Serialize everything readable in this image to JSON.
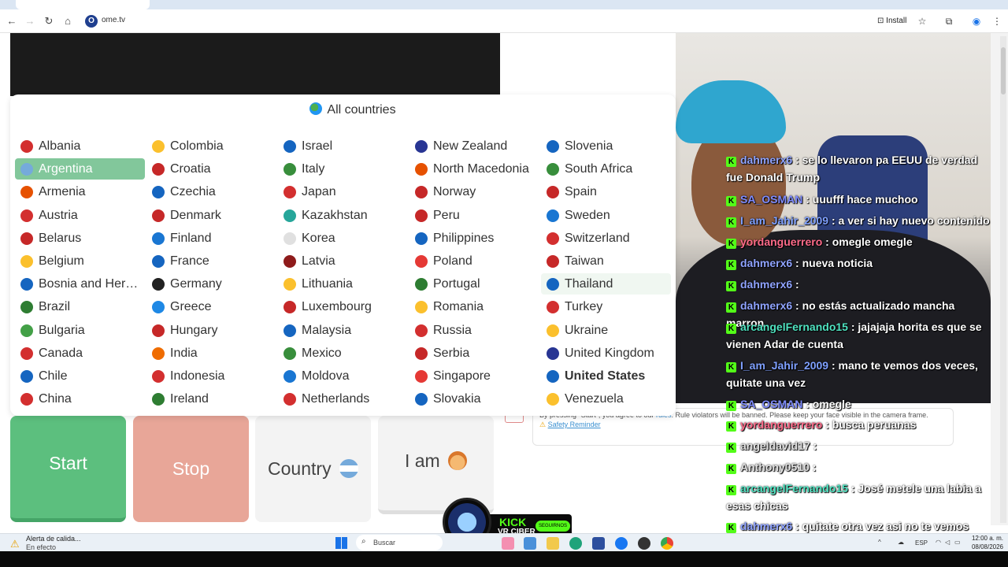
{
  "browser": {
    "url": "ome.tv",
    "install_label": "Install",
    "site_icon_letter": "O"
  },
  "country_panel": {
    "title": "All countries",
    "selected": "Argentina",
    "hovered": "Thailand",
    "columns": [
      [
        "Albania",
        "Argentina",
        "Armenia",
        "Austria",
        "Belarus",
        "Belgium",
        "Bosnia and Her…",
        "Brazil",
        "Bulgaria",
        "Canada",
        "Chile",
        "China"
      ],
      [
        "Colombia",
        "Croatia",
        "Czechia",
        "Denmark",
        "Finland",
        "France",
        "Germany",
        "Greece",
        "Hungary",
        "India",
        "Indonesia",
        "Ireland"
      ],
      [
        "Israel",
        "Italy",
        "Japan",
        "Kazakhstan",
        "Korea",
        "Latvia",
        "Lithuania",
        "Luxembourg",
        "Malaysia",
        "Mexico",
        "Moldova",
        "Netherlands"
      ],
      [
        "New Zealand",
        "North Macedonia",
        "Norway",
        "Peru",
        "Philippines",
        "Poland",
        "Portugal",
        "Romania",
        "Russia",
        "Serbia",
        "Singapore",
        "Slovakia"
      ],
      [
        "Slovenia",
        "South Africa",
        "Spain",
        "Sweden",
        "Switzerland",
        "Taiwan",
        "Thailand",
        "Turkey",
        "Ukraine",
        "United Kingdom",
        "United States",
        "Venezuela"
      ]
    ],
    "bold_items": [
      "United States"
    ]
  },
  "controls": {
    "start_label": "Start",
    "stop_label": "Stop",
    "country_label": "Country",
    "iam_label": "I am"
  },
  "rules": {
    "text_before": "By pressing \"Start\", you agree to our",
    "rules_link": "rules",
    "text_after": ". Rule violators will be banned. Please keep your face visible in the camera frame.",
    "safety_link": "Safety Reminder"
  },
  "chat": {
    "messages": [
      {
        "user": "dahmerx6",
        "color": "#8fa3ff",
        "text": ": se lo llevaron pa EEUU de verdad fue Donald Trump"
      },
      {
        "user": "SA_OSMAN",
        "color": "#7f8cff",
        "text": ": uuufff hace muchoo"
      },
      {
        "user": "I_am_Jahir_2009",
        "color": "#7fa0ff",
        "text": ": a ver si hay nuevo contenido"
      },
      {
        "user": "yordanguerrero",
        "color": "#ff6b8a",
        "text": ": omegle omegle"
      },
      {
        "user": "dahmerx6",
        "color": "#8fa3ff",
        "text": ": nueva noticia"
      },
      {
        "user": "dahmerx6",
        "color": "#8fa3ff",
        "text": ":"
      },
      {
        "user": "dahmerx6",
        "color": "#8fa3ff",
        "text": ": no estás actualizado mancha marron"
      },
      {
        "user": "arcangelFernando15",
        "color": "#4fe3c1",
        "text": ": jajajaja horita es que se vienen Adar de cuenta"
      },
      {
        "user": "I_am_Jahir_2009",
        "color": "#7fa0ff",
        "text": ": mano te vemos dos veces, quitate una vez"
      },
      {
        "user": "SA_OSMAN",
        "color": "#7f8cff",
        "text": ": omegle"
      },
      {
        "user": "yordanguerrero",
        "color": "#ff6b8a",
        "text": ": busca peruanas"
      },
      {
        "user": "angeldavid17",
        "color": "#e0e0e0",
        "text": ":"
      },
      {
        "user": "Anthony0510",
        "color": "#e0e0e0",
        "text": ":"
      },
      {
        "user": "arcangelFernando15",
        "color": "#4fe3c1",
        "text": ": José metele una labia a esas chicas"
      },
      {
        "user": "dahmerx6",
        "color": "#8fa3ff",
        "text": ": quitate otra vez asi no te vemos"
      }
    ]
  },
  "kick": {
    "brand": "KICK",
    "channel": "VR CIBER",
    "follow_label": "SEGUIRNOS"
  },
  "taskbar": {
    "alert_title": "Alerta de calida...",
    "alert_sub": "En efecto",
    "search_placeholder": "Buscar",
    "lang": "ESP",
    "time": "12:00 a. m.",
    "date": "08/08/2026"
  }
}
